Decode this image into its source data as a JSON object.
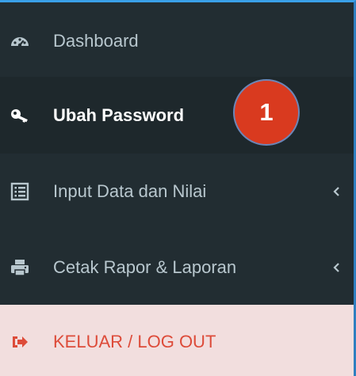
{
  "sidebar": {
    "items": [
      {
        "label": "Dashboard",
        "icon": "dashboard-icon"
      },
      {
        "label": "Ubah Password",
        "icon": "key-icon",
        "active": true
      },
      {
        "label": "Input Data dan Nilai",
        "icon": "list-icon",
        "submenu_indicator": "chevron-left-icon"
      },
      {
        "label": "Cetak Rapor & Laporan",
        "icon": "printer-icon",
        "submenu_indicator": "chevron-left-icon"
      },
      {
        "label": "KELUAR / LOG OUT",
        "icon": "sign-out-icon"
      }
    ]
  },
  "annotation": {
    "step_number": "1"
  },
  "colors": {
    "sidebar_bg": "#222d32",
    "active_bg": "#1e282c",
    "text": "#b8c7ce",
    "active_text": "#ffffff",
    "logout_bg": "#f2dede",
    "logout_text": "#dd4b39",
    "badge_bg": "#d93a1f",
    "frame_border": "#3aa0e8"
  }
}
